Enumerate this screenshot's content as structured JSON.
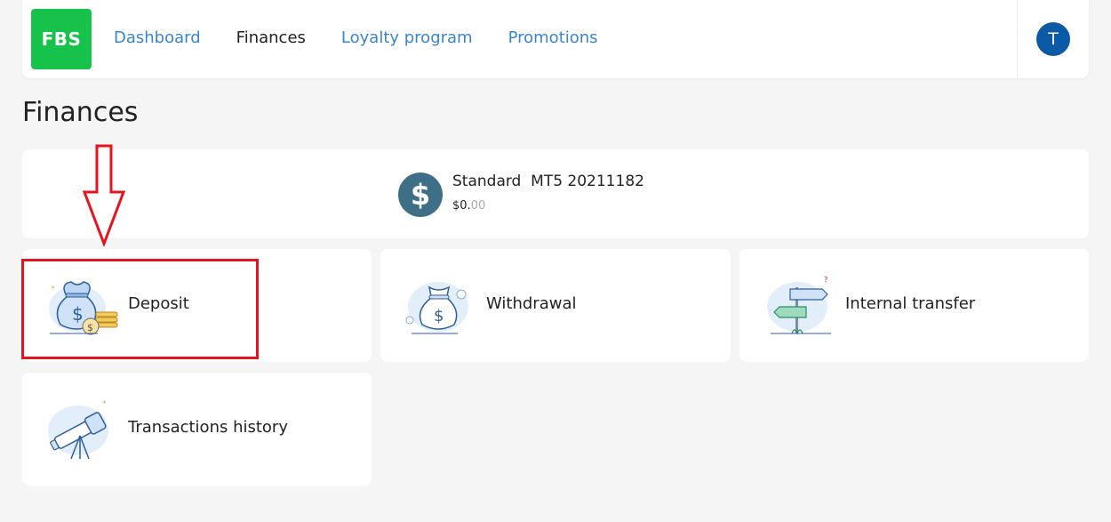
{
  "brand": {
    "logo_text": "FBS",
    "color": "#17c24a"
  },
  "nav": {
    "items": [
      {
        "label": "Dashboard",
        "active": false
      },
      {
        "label": "Finances",
        "active": true
      },
      {
        "label": "Loyalty program",
        "active": false
      },
      {
        "label": "Promotions",
        "active": false
      }
    ],
    "link_color": "#3b86c8"
  },
  "user": {
    "avatar_initial": "T",
    "avatar_color": "#0b5aa6"
  },
  "page": {
    "title": "Finances"
  },
  "account": {
    "icon": "dollar-icon",
    "name": "Standard  MT5 20211182",
    "balance_main": "$0.",
    "balance_cents": "00"
  },
  "actions": [
    {
      "label": "Deposit",
      "icon": "money-bag-coins-icon"
    },
    {
      "label": "Withdrawal",
      "icon": "money-bag-icon"
    },
    {
      "label": "Internal transfer",
      "icon": "signpost-icon"
    },
    {
      "label": "Transactions history",
      "icon": "telescope-icon"
    }
  ],
  "annotation": {
    "color": "#e3151f"
  }
}
